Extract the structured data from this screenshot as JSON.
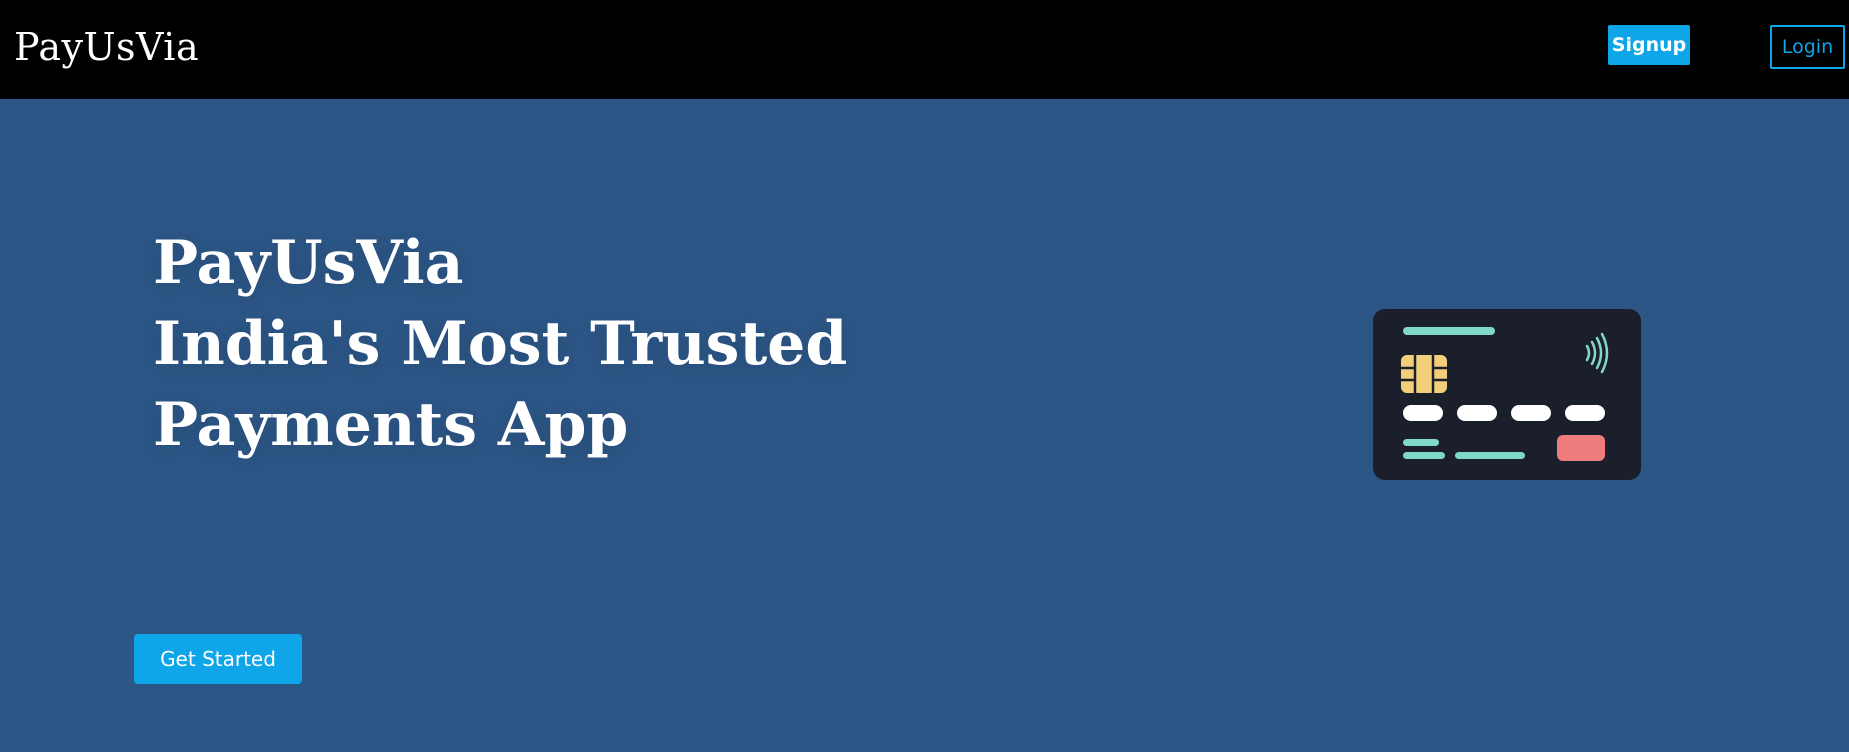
{
  "navbar": {
    "brand": "PayUsVia",
    "signup_label": "Signup",
    "login_label": "Login"
  },
  "hero": {
    "title_lines": [
      "PayUsVia",
      "India's Most Trusted",
      "Payments App"
    ],
    "cta_label": "Get Started"
  },
  "card": {
    "icons": [
      "chip-icon",
      "contactless-icon"
    ]
  },
  "colors": {
    "navbar_bg": "#000000",
    "page_bg": "#2c5686",
    "accent": "#0ea5e9",
    "card_bg": "#1b1f2b",
    "card_teal": "#7fd8c8",
    "card_chip": "#f4cf7a",
    "card_red": "#ef7c7c"
  }
}
